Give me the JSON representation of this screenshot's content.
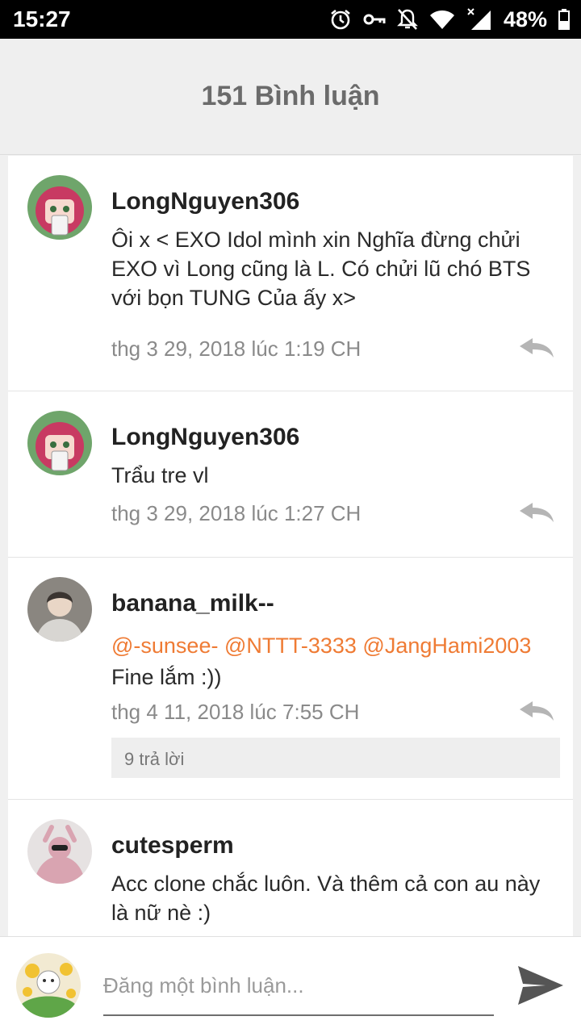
{
  "status_bar": {
    "time": "15:27",
    "battery": "48%",
    "icons": [
      "alarm-icon",
      "vpn-key-icon",
      "notifications-off-icon",
      "wifi-icon",
      "cell-signal-icon",
      "battery-icon"
    ]
  },
  "header": {
    "title": "151 Bình luận"
  },
  "colors": {
    "mention": "#ef7b34",
    "username": "#222222",
    "meta": "#8a8a8a",
    "send": "#555555"
  },
  "comments": [
    {
      "username": "LongNguyen306",
      "text": "Ôi x < EXO Idol mình xin Nghĩa đừng chửi EXO vì Long cũng là L. Có chửi lũ chó BTS với bọn TUNG Của ấy x>",
      "timestamp": "thg 3 29, 2018 lúc 1:19 CH",
      "avatar": "anime-girl-avatar"
    },
    {
      "username": "LongNguyen306",
      "text": "Trẩu tre vl",
      "timestamp": "thg 3 29, 2018 lúc 1:27 CH",
      "avatar": "anime-girl-avatar"
    },
    {
      "username": "banana_milk--",
      "mentions": "@-sunsee- @NTTT-3333 @JangHami2003",
      "text": "Fine lắm :))",
      "timestamp": "thg 4 11, 2018 lúc 7:55 CH",
      "replies": "9 trả lời",
      "avatar": "person-photo-avatar"
    },
    {
      "username": "cutesperm",
      "text": "Acc clone chắc luôn. Và thêm cả con au này là nữ nè :)",
      "avatar": "pink-hoodie-avatar"
    }
  ],
  "composer": {
    "placeholder": "Đăng một bình luận...",
    "avatar": "flower-cat-avatar",
    "send_icon": "send-icon"
  }
}
